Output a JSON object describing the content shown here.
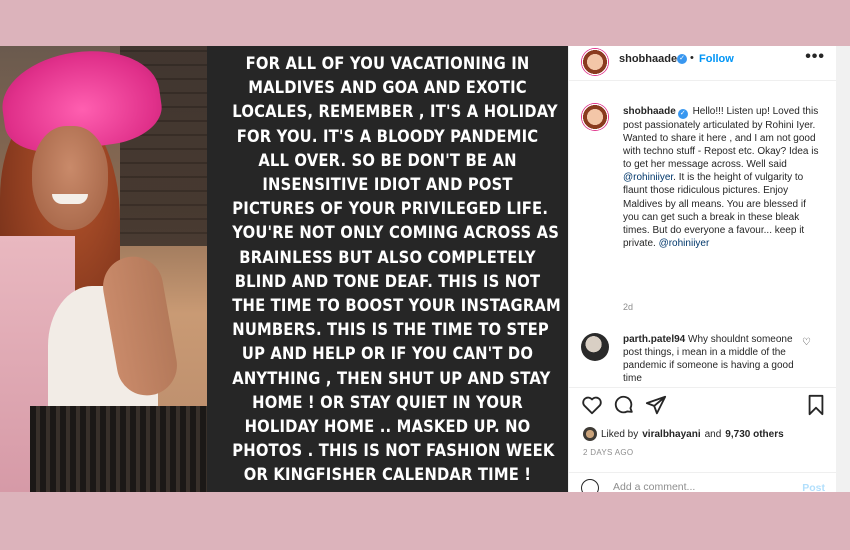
{
  "story": {
    "lines": [
      "FOR ALL OF YOU VACATIONING IN",
      "MALDIVES AND GOA AND EXOTIC",
      "LOCALES, REMEMBER , IT'S A HOLIDAY",
      "FOR  YOU. IT'S A BLOODY PANDEMIC",
      "ALL OVER. SO BE DON'T BE AN",
      "INSENSITIVE  IDIOT AND POST",
      "PICTURES OF YOUR PRIVILEGED LIFE.",
      "YOU'RE NOT ONLY COMING ACROSS AS",
      "BRAINLESS  BUT ALSO COMPLETELY",
      "BLIND AND TONE DEAF. THIS IS NOT",
      "THE TIME TO BOOST YOUR INSTAGRAM",
      "NUMBERS. THIS IS THE TIME TO STEP",
      "UP AND HELP OR IF YOU CAN'T DO",
      "ANYTHING , THEN SHUT UP AND STAY",
      "HOME ! OR STAY QUIET IN YOUR",
      "HOLIDAY HOME .. MASKED UP. NO",
      "PHOTOS . THIS IS NOT FASHION WEEK",
      "OR KINGFISHER CALENDAR TIME !"
    ]
  },
  "header": {
    "username": "shobhaade",
    "separator": "•",
    "follow_label": "Follow",
    "more_label": "•••"
  },
  "caption": {
    "username": "shobhaade",
    "text_before": "Hello!!! Listen up! Loved this post passionately articulated by Rohini Iyer. Wanted to share it here , and I am not good with techno stuff - Repost etc. Okay? Idea is to get her message across. Well said ",
    "mention1": "@rohiniiyer",
    "text_after": ". It is the height of vulgarity to flaunt those ridiculous pictures. Enjoy Maldives by all means. You are blessed if you can get such a break in these bleak times. But do everyone a favour... keep it private. ",
    "mention2": "@rohiniiyer",
    "time": "2d"
  },
  "comment": {
    "username": "parth.patel94",
    "text": "Why shouldnt someone post things, i mean in a middle of the pandemic if someone is having a good time"
  },
  "likes": {
    "prefix": "Liked by",
    "user": "viralbhayani",
    "joiner": "and",
    "others": "9,730 others"
  },
  "date": "2 DAYS AGO",
  "add_comment": {
    "placeholder": "Add a comment...",
    "post_label": "Post"
  },
  "colors": {
    "background": "#dcb3bb",
    "story_bg": "#262626",
    "accent": "#0095f6"
  }
}
